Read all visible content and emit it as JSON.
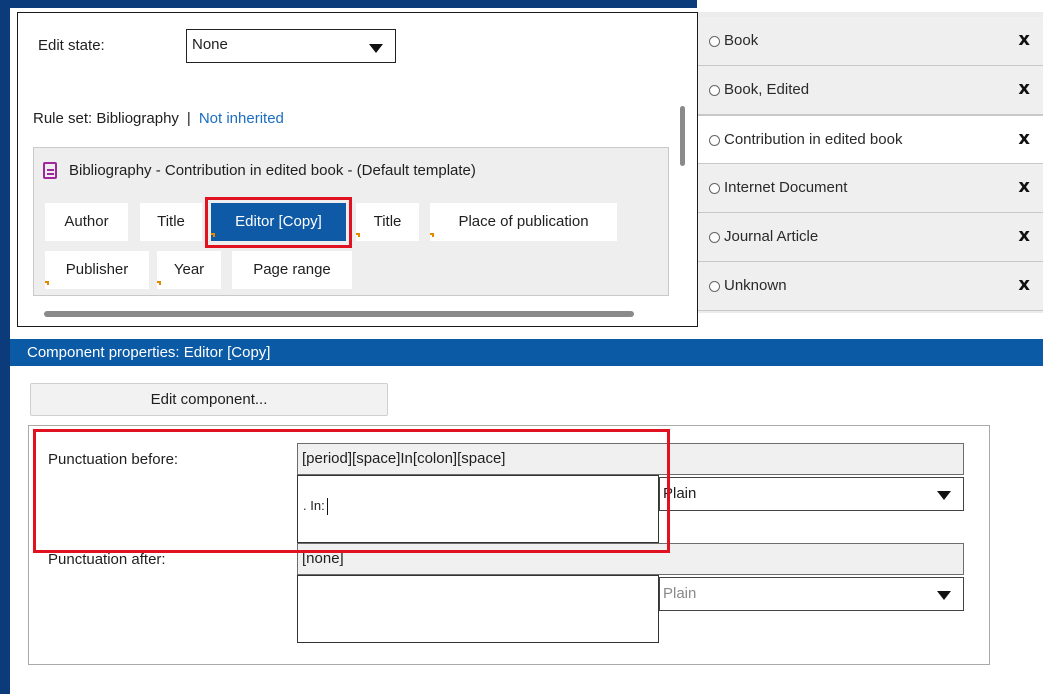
{
  "editor": {
    "edit_state_label": "Edit state:",
    "edit_state_value": "None",
    "ruleset_label": "Rule set: Bibliography",
    "ruleset_sep": "|",
    "ruleset_link": "Not inherited",
    "template_title": "Bibliography - Contribution in edited book - (Default template)",
    "chips": [
      {
        "label": "Author",
        "arrow": false,
        "selected": false
      },
      {
        "label": "Title",
        "arrow": false,
        "selected": false
      },
      {
        "label": "Editor [Copy]",
        "arrow": true,
        "selected": true
      },
      {
        "label": "Title",
        "arrow": true,
        "selected": false
      },
      {
        "label": "Place of publication",
        "arrow": true,
        "selected": false
      },
      {
        "label": "Publisher",
        "arrow": true,
        "selected": false
      },
      {
        "label": "Year",
        "arrow": true,
        "selected": false
      },
      {
        "label": "Page range",
        "arrow": false,
        "selected": false
      }
    ]
  },
  "templates_list": {
    "items": [
      {
        "label": "Book",
        "close": "x",
        "active": false
      },
      {
        "label": "Book, Edited",
        "close": "x",
        "active": false
      },
      {
        "label": "Contribution in edited book",
        "close": "x",
        "active": true
      },
      {
        "label": "Internet Document",
        "close": "x",
        "active": false
      },
      {
        "label": "Journal Article",
        "close": "x",
        "active": false
      },
      {
        "label": "Unknown",
        "close": "x",
        "active": false
      }
    ]
  },
  "properties": {
    "header": "Component properties:  Editor [Copy]",
    "edit_button": "Edit component...",
    "punct_before": {
      "label": "Punctuation before:",
      "code": "[period][space]In[colon][space]",
      "text": ". In:",
      "style": "Plain"
    },
    "punct_after": {
      "label": "Punctuation after:",
      "code": "[none]",
      "text": "",
      "style": "Plain"
    }
  },
  "colors": {
    "accent": "#0b5aa5",
    "frame": "#0b3b7a",
    "highlight": "#e01222",
    "chip_arrow": "#e58a00",
    "doc_icon": "#a0279b"
  },
  "icons": [
    "doc-icon",
    "chevron-down-icon",
    "radio-icon",
    "close-icon",
    "insert-arrow-icon"
  ]
}
